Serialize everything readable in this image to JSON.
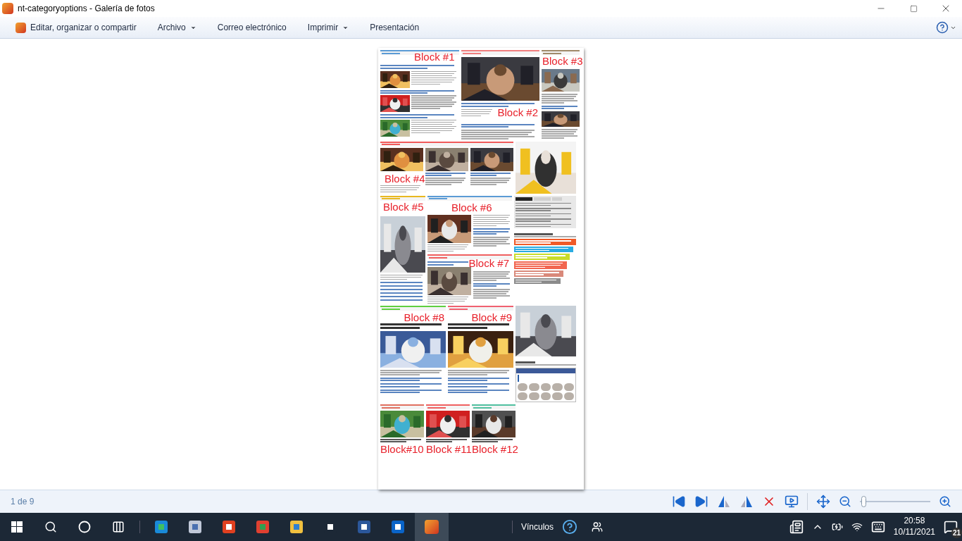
{
  "window": {
    "title": "nt-categoryoptions - Galería de fotos"
  },
  "toolbar": [
    {
      "kind": "app",
      "label": "Editar, organizar o compartir"
    },
    {
      "kind": "menu",
      "label": "Archivo"
    },
    {
      "kind": "plain",
      "label": "Correo electrónico"
    },
    {
      "kind": "menu",
      "label": "Imprimir"
    },
    {
      "kind": "plain",
      "label": "Presentación"
    }
  ],
  "page": {
    "blocks": [
      {
        "label": "Block #1"
      },
      {
        "label": "Block #2"
      },
      {
        "label": "Block #3"
      },
      {
        "label": "Block #4"
      },
      {
        "label": "Block #5"
      },
      {
        "label": "Block #6"
      },
      {
        "label": "Block #7"
      },
      {
        "label": "Block #8"
      },
      {
        "label": "Block #9"
      },
      {
        "label": "Block#10"
      },
      {
        "label": "Block #11"
      },
      {
        "label": "Block #12"
      }
    ],
    "sidebar_tabs": [
      {
        "selected": true
      },
      {
        "selected": false
      },
      {
        "selected": false
      }
    ]
  },
  "status": {
    "position": "1 de 9",
    "zoom": {
      "level": 0.02
    }
  },
  "taskbar": {
    "links": "Vínculos",
    "time": "20:58",
    "date": "10/11/2021",
    "notifications": "21"
  }
}
